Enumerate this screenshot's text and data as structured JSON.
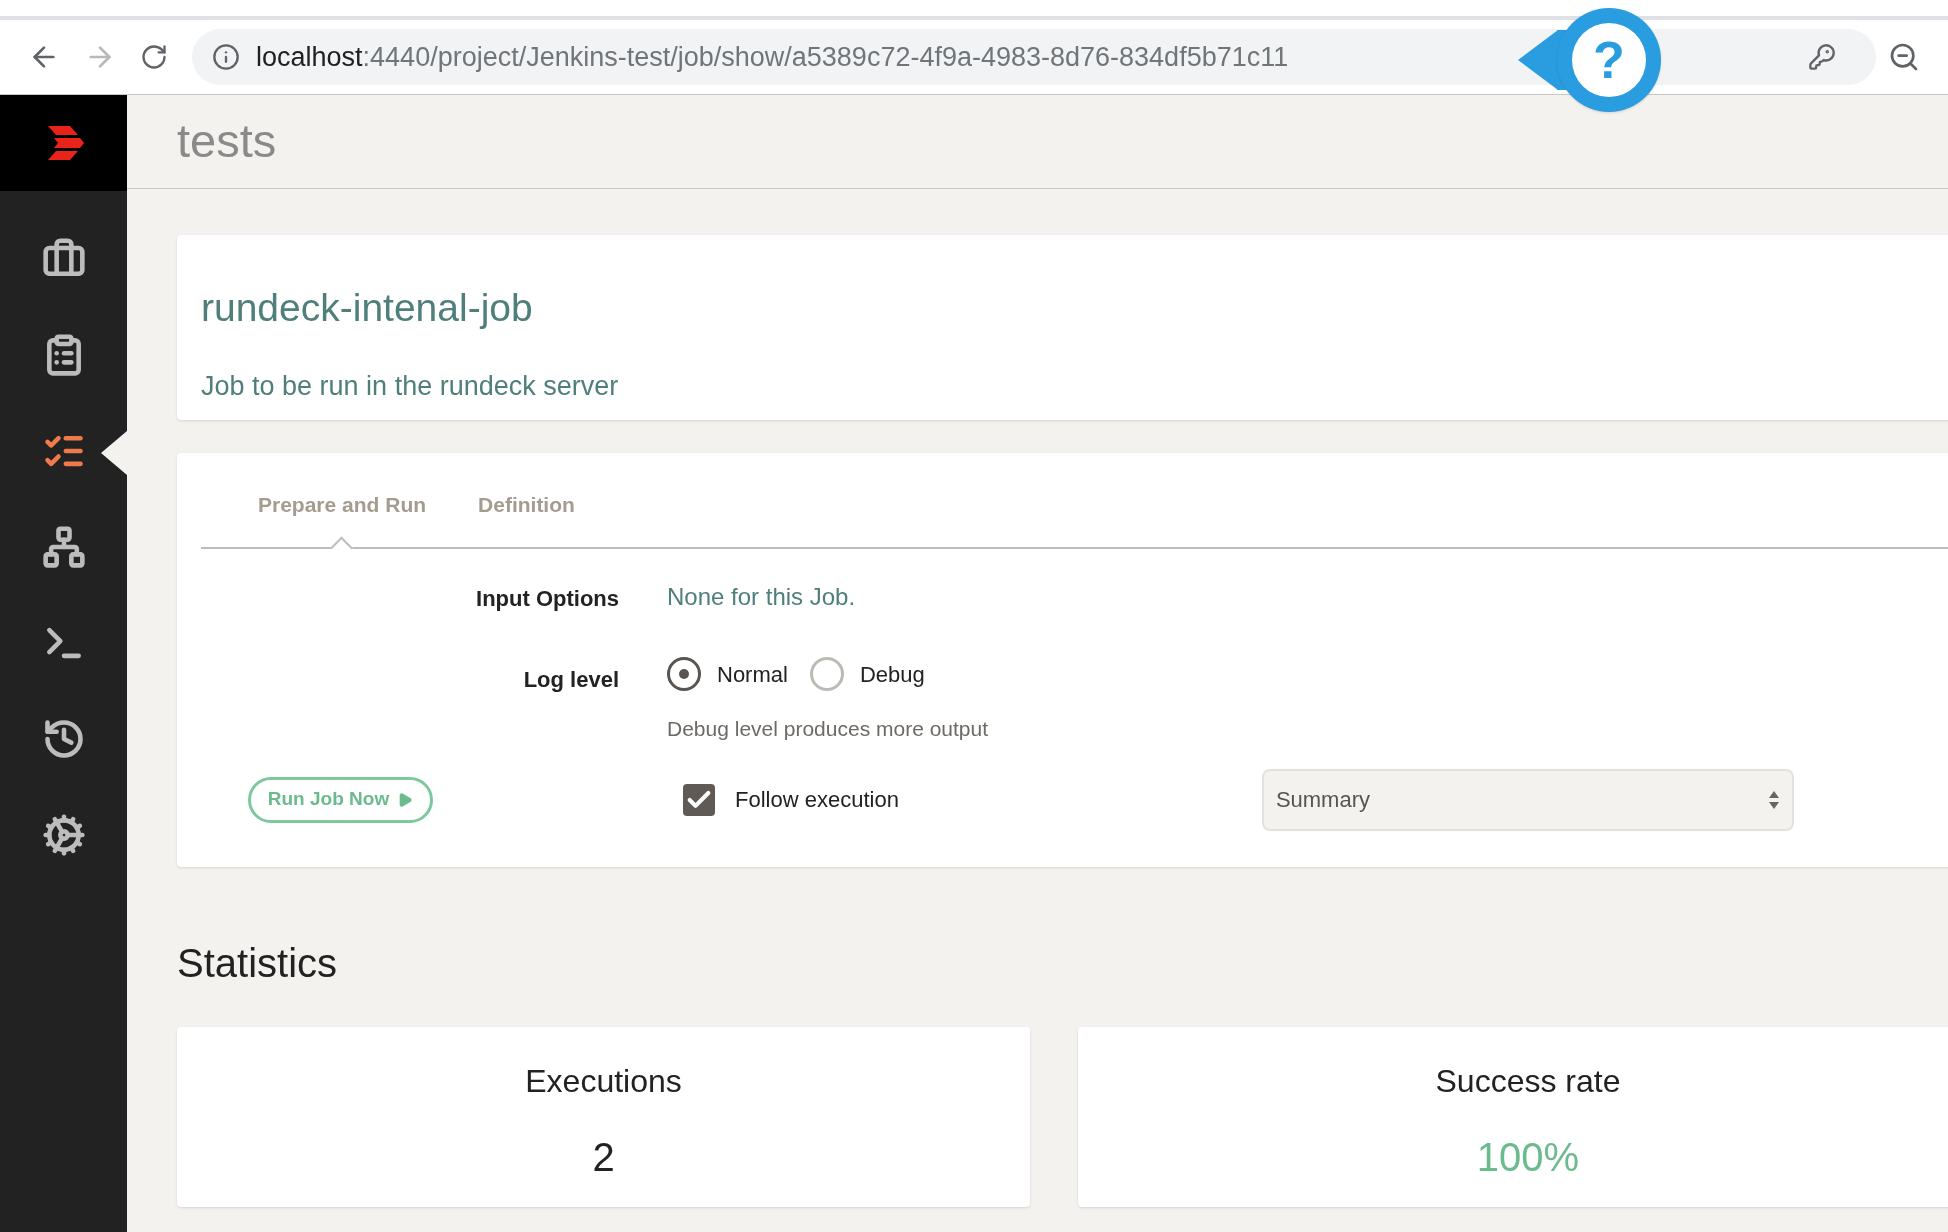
{
  "browser": {
    "url_host": "localhost",
    "url_path": ":4440/project/Jenkins-test/job/show/a5389c72-4f9a-4983-8d76-834df5b71c11"
  },
  "help_badge": "?",
  "project_title": "tests",
  "sidebar": {
    "items": [
      {
        "selected": false
      },
      {
        "selected": false
      },
      {
        "selected": true
      },
      {
        "selected": false
      },
      {
        "selected": false
      },
      {
        "selected": false
      },
      {
        "selected": false
      }
    ]
  },
  "job": {
    "name": "rundeck-intenal-job",
    "description": "Job to be run in the rundeck server"
  },
  "tabs": [
    {
      "label": "Prepare and Run",
      "selected": true
    },
    {
      "label": "Definition",
      "selected": false
    }
  ],
  "input_options": {
    "label": "Input Options",
    "value": "None for this Job."
  },
  "log_level": {
    "label": "Log level",
    "options": [
      {
        "label": "Normal",
        "selected": true
      },
      {
        "label": "Debug",
        "selected": false
      }
    ],
    "hint": "Debug level produces more output"
  },
  "run_button": "Run Job Now",
  "follow_execution": {
    "label": "Follow execution",
    "checked": true
  },
  "output_select": {
    "value": "Summary"
  },
  "statistics": {
    "title": "Statistics",
    "cards": [
      {
        "label": "Executions",
        "value": "2",
        "kind": "count"
      },
      {
        "label": "Success rate",
        "value": "100%",
        "kind": "rate"
      }
    ]
  }
}
